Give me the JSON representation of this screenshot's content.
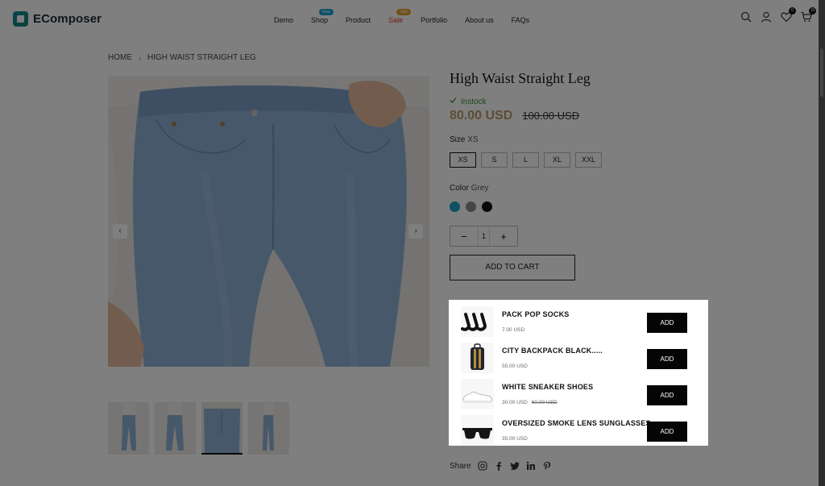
{
  "brand": {
    "name": "EComposer"
  },
  "nav": {
    "items": [
      {
        "label": "Demo",
        "badge": ""
      },
      {
        "label": "Shop",
        "badge": "New"
      },
      {
        "label": "Product",
        "badge": ""
      },
      {
        "label": "Sale",
        "badge": "Sale"
      },
      {
        "label": "Portfolio",
        "badge": ""
      },
      {
        "label": "About us",
        "badge": ""
      },
      {
        "label": "FAQs",
        "badge": ""
      }
    ]
  },
  "header_icons": {
    "wishlist_count": "0",
    "cart_count": "10"
  },
  "breadcrumb": {
    "home": "HOME",
    "sep": "›",
    "current": "HIGH WAIST STRAIGHT LEG"
  },
  "product": {
    "title": "High Waist Straight Leg",
    "stock": "Instock",
    "price": "80.00 USD",
    "compare_price": "100.00 USD",
    "size_label": "Size",
    "size_value": "XS",
    "sizes": [
      "XS",
      "S",
      "L",
      "XL",
      "XXL"
    ],
    "color_label": "Color",
    "color_value": "Grey",
    "swatches": [
      "#1aa3c4",
      "#8a8a8a",
      "#111111"
    ],
    "qty_minus": "−",
    "qty_value": "1",
    "qty_plus": "+",
    "add_to_cart": "ADD TO CART"
  },
  "upsell": [
    {
      "name": "PACK POP SOCKS",
      "price": "7.00 USD",
      "old": "",
      "add": "ADD",
      "icon": "socks-icon"
    },
    {
      "name": "CITY BACKPACK BLACK.....",
      "price": "55.00 USD",
      "old": "",
      "add": "ADD",
      "icon": "backpack-icon"
    },
    {
      "name": "WHITE SNEAKER SHOES",
      "price": "30.00 USD",
      "old": "60.00 USD",
      "add": "ADD",
      "icon": "sneaker-icon"
    },
    {
      "name": "OVERSIZED SMOKE LENS SUNGLASSES",
      "price": "35.00 USD",
      "old": "",
      "add": "ADD",
      "icon": "sunglasses-icon"
    }
  ],
  "share": {
    "label": "Share"
  },
  "colors": {
    "accent_price": "#b89a6a",
    "stock_green": "#3a8f3a",
    "sale_red": "#e0382c",
    "badge_blue": "#1aa1d6",
    "badge_orange": "#e6a030"
  }
}
